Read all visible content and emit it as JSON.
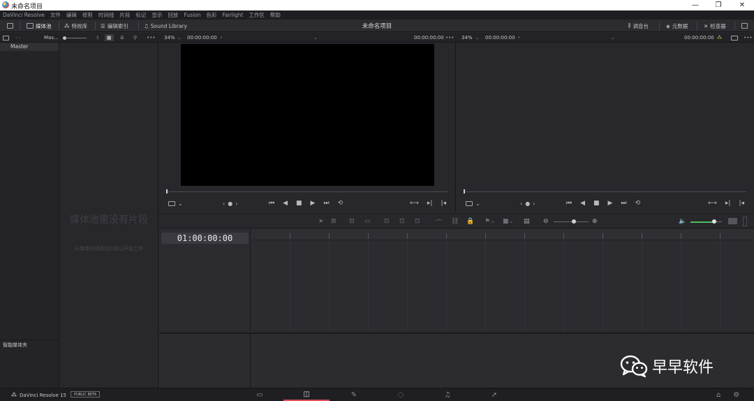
{
  "window": {
    "title": "未命名项目",
    "controls": [
      "—",
      "❐",
      "✕"
    ]
  },
  "menu": [
    "DaVinci Resolve",
    "文件",
    "编辑",
    "修剪",
    "时间线",
    "片段",
    "标记",
    "显示",
    "回放",
    "Fusion",
    "色彩",
    "Fairlight",
    "工作区",
    "帮助"
  ],
  "toolbar": {
    "media_pool": "媒体池",
    "effects": "特效库",
    "edit_index": "编辑索引",
    "sound_library": "Sound Library",
    "project_title": "未命名项目",
    "mixer": "调音台",
    "metadata": "元数据",
    "inspector": "检查器"
  },
  "subbar": {
    "bin_label": "Mas...",
    "src_zoom": "34%",
    "src_timecode": "00:00:00:00",
    "src_duration": "00:00:00:00",
    "tl_zoom": "34%",
    "tl_timecode": "00:00:00:00",
    "tl_duration": "00:00:00:00"
  },
  "bins": {
    "master": "Master",
    "smart_bins": "智能媒体夹"
  },
  "media_pool": {
    "empty_title": "媒体池里没有片段",
    "empty_hint": "从媒体存储添加片段以开始工作"
  },
  "timeline": {
    "timecode": "01:00:00:00"
  },
  "watermark": {
    "text": "早早软件"
  },
  "footer": {
    "app_name": "DaVinci Resolve 15",
    "badge": "PUBLIC BETA",
    "pages": [
      "media",
      "edit",
      "fusion",
      "color",
      "fairlight",
      "deliver"
    ]
  }
}
